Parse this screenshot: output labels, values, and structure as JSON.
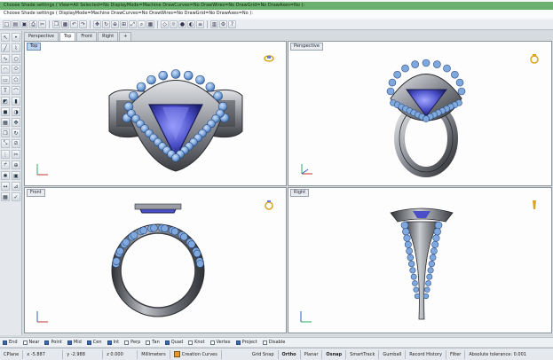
{
  "command_history": {
    "line1": "Choose Shade settings ( View=All  Selected=No  DisplayMode=Machine  DrawCurves=No  DrawWires=No  DrawGrid=No  DrawAxes=No ):",
    "line2": "Choose Shade settings ( DisplayMode=Machine  DrawCurves=No  DrawWires=No  DrawGrid=No  DrawAxes=No ):"
  },
  "viewport_tabs": [
    "Perspective",
    "Top",
    "Front",
    "Right",
    "+"
  ],
  "viewports": {
    "top": {
      "title": "Top"
    },
    "perspective": {
      "title": "Perspective"
    },
    "front": {
      "title": "Front"
    },
    "right": {
      "title": "Right"
    }
  },
  "axis_labels": {
    "x": "x",
    "y": "y",
    "z": "z"
  },
  "snaps": [
    {
      "label": "End",
      "checked": true
    },
    {
      "label": "Near",
      "checked": false
    },
    {
      "label": "Point",
      "checked": true
    },
    {
      "label": "Mid",
      "checked": true
    },
    {
      "label": "Cen",
      "checked": true
    },
    {
      "label": "Int",
      "checked": true
    },
    {
      "label": "Perp",
      "checked": false
    },
    {
      "label": "Tan",
      "checked": false
    },
    {
      "label": "Quad",
      "checked": true
    },
    {
      "label": "Knot",
      "checked": false
    },
    {
      "label": "Vertex",
      "checked": false
    },
    {
      "label": "Project",
      "checked": true
    },
    {
      "label": "Disable",
      "checked": false
    }
  ],
  "status": {
    "cplane": "CPlane",
    "x": "x -5.887",
    "y": "y -2.988",
    "z": "z 0.000",
    "units": "Millimeters",
    "layer": "Creation Curves",
    "layer_color": "#e39a2e",
    "grid_snap": "Grid Snap",
    "ortho": "Ortho",
    "planar": "Planar",
    "osnap": "Osnap",
    "smarttrack": "SmartTrack",
    "gumball": "Gumball",
    "record_history": "Record History",
    "filter": "Filter",
    "tolerance": "Absolute tolerance: 0.001"
  },
  "colors": {
    "command_highlight": "#6cb06f",
    "active_viewport_title": "#bcd3ec",
    "gem_blue": "#4a4fc8",
    "metal": "#8c8f96",
    "stone_light": "#7fa9de"
  },
  "icons": {
    "top_toolbar": [
      "new-icon",
      "open-icon",
      "save-icon",
      "print-icon",
      "cut-icon",
      "copy-icon",
      "paste-icon",
      "undo-icon",
      "redo-icon",
      "pan-icon",
      "rotate-icon",
      "zoom-icon",
      "zoom-window-icon",
      "zoom-extents-icon",
      "zoom-selected-icon",
      "four-views-icon",
      "cplane-icon",
      "light-icon",
      "render-icon",
      "material-icon",
      "layer-icon",
      "properties-icon",
      "options-icon",
      "help-icon"
    ],
    "left_toolbar": [
      "select-icon",
      "point-icon",
      "line-icon",
      "polyline-icon",
      "curve-icon",
      "circle-icon",
      "arc-icon",
      "ellipse-icon",
      "rectangle-icon",
      "polygon-icon",
      "text-icon",
      "fillet-icon",
      "surface-icon",
      "extrude-icon",
      "solid-icon",
      "boolean-icon",
      "mesh-icon",
      "move-icon",
      "copy-tool-icon",
      "rotate-tool-icon",
      "scale-icon",
      "mirror-icon",
      "array-icon",
      "trim-icon",
      "split-icon",
      "join-icon",
      "explode-icon",
      "group-icon",
      "dimension-icon",
      "analyze-icon",
      "grid-icon",
      "check-icon"
    ]
  }
}
